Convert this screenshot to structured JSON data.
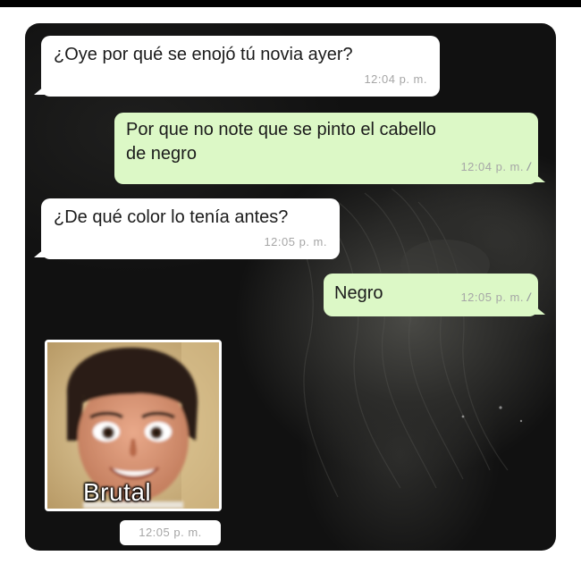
{
  "messages": [
    {
      "direction": "incoming",
      "text": "¿Oye por qué se enojó tú novia ayer?",
      "time": "12:04 p. m."
    },
    {
      "direction": "outgoing",
      "text": "Por que no note que se pinto el cabello\nde negro",
      "time": "12:04 p. m.",
      "status": "read"
    },
    {
      "direction": "incoming",
      "text": "¿De qué color lo tenía antes?",
      "time": "12:05 p. m."
    },
    {
      "direction": "outgoing",
      "text": "Negro",
      "time": "12:05 p. m.",
      "status": "read"
    }
  ],
  "image_message": {
    "caption": "Brutal",
    "time": "12:05 p. m."
  },
  "colors": {
    "incoming_bubble": "#ffffff",
    "outgoing_bubble": "#dcf8c6",
    "wallpaper": "#111111",
    "timestamp": "#a6a6a6"
  },
  "icons": {
    "read_receipt": "double-check-icon"
  }
}
